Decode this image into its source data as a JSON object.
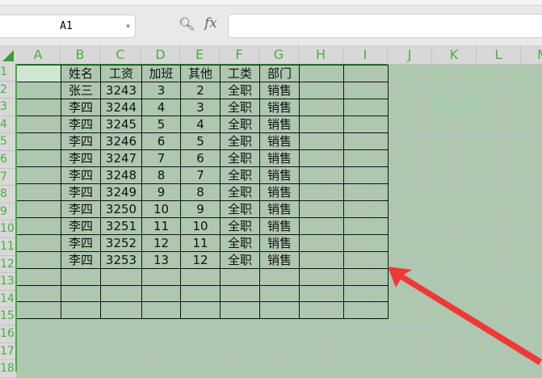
{
  "name_box": {
    "value": "A1"
  },
  "formula_bar": {
    "fx_label": "fx",
    "value": ""
  },
  "columns": [
    "A",
    "B",
    "C",
    "D",
    "E",
    "F",
    "G",
    "H",
    "I",
    "J",
    "K",
    "L",
    "M"
  ],
  "rows": [
    "1",
    "2",
    "3",
    "4",
    "5",
    "6",
    "7",
    "8",
    "9",
    "10",
    "11",
    "12",
    "13",
    "14",
    "15",
    "16",
    "17",
    "18"
  ],
  "table": {
    "header": [
      "",
      "姓名",
      "工资",
      "加班",
      "其他",
      "工类",
      "部门",
      "",
      ""
    ],
    "rows": [
      [
        "",
        "张三",
        "3243",
        "3",
        "2",
        "全职",
        "销售",
        "",
        ""
      ],
      [
        "",
        "李四",
        "3244",
        "4",
        "3",
        "全职",
        "销售",
        "",
        ""
      ],
      [
        "",
        "李四",
        "3245",
        "5",
        "4",
        "全职",
        "销售",
        "",
        ""
      ],
      [
        "",
        "李四",
        "3246",
        "6",
        "5",
        "全职",
        "销售",
        "",
        ""
      ],
      [
        "",
        "李四",
        "3247",
        "7",
        "6",
        "全职",
        "销售",
        "",
        ""
      ],
      [
        "",
        "李四",
        "3248",
        "8",
        "7",
        "全职",
        "销售",
        "",
        ""
      ],
      [
        "",
        "李四",
        "3249",
        "9",
        "8",
        "全职",
        "销售",
        "",
        ""
      ],
      [
        "",
        "李四",
        "3250",
        "10",
        "9",
        "全职",
        "销售",
        "",
        ""
      ],
      [
        "",
        "李四",
        "3251",
        "11",
        "10",
        "全职",
        "销售",
        "",
        ""
      ],
      [
        "",
        "李四",
        "3252",
        "12",
        "11",
        "全职",
        "销售",
        "",
        ""
      ],
      [
        "",
        "李四",
        "3253",
        "13",
        "12",
        "全职",
        "销售",
        "",
        ""
      ],
      [
        "",
        "",
        "",
        "",
        "",
        "",
        "",
        "",
        ""
      ],
      [
        "",
        "",
        "",
        "",
        "",
        "",
        "",
        "",
        ""
      ],
      [
        "",
        "",
        "",
        "",
        "",
        "",
        "",
        "",
        ""
      ]
    ]
  },
  "colors": {
    "accent": "#3fae3f",
    "sheet_bg": "#adc8ae",
    "arrow": "#f03838"
  }
}
